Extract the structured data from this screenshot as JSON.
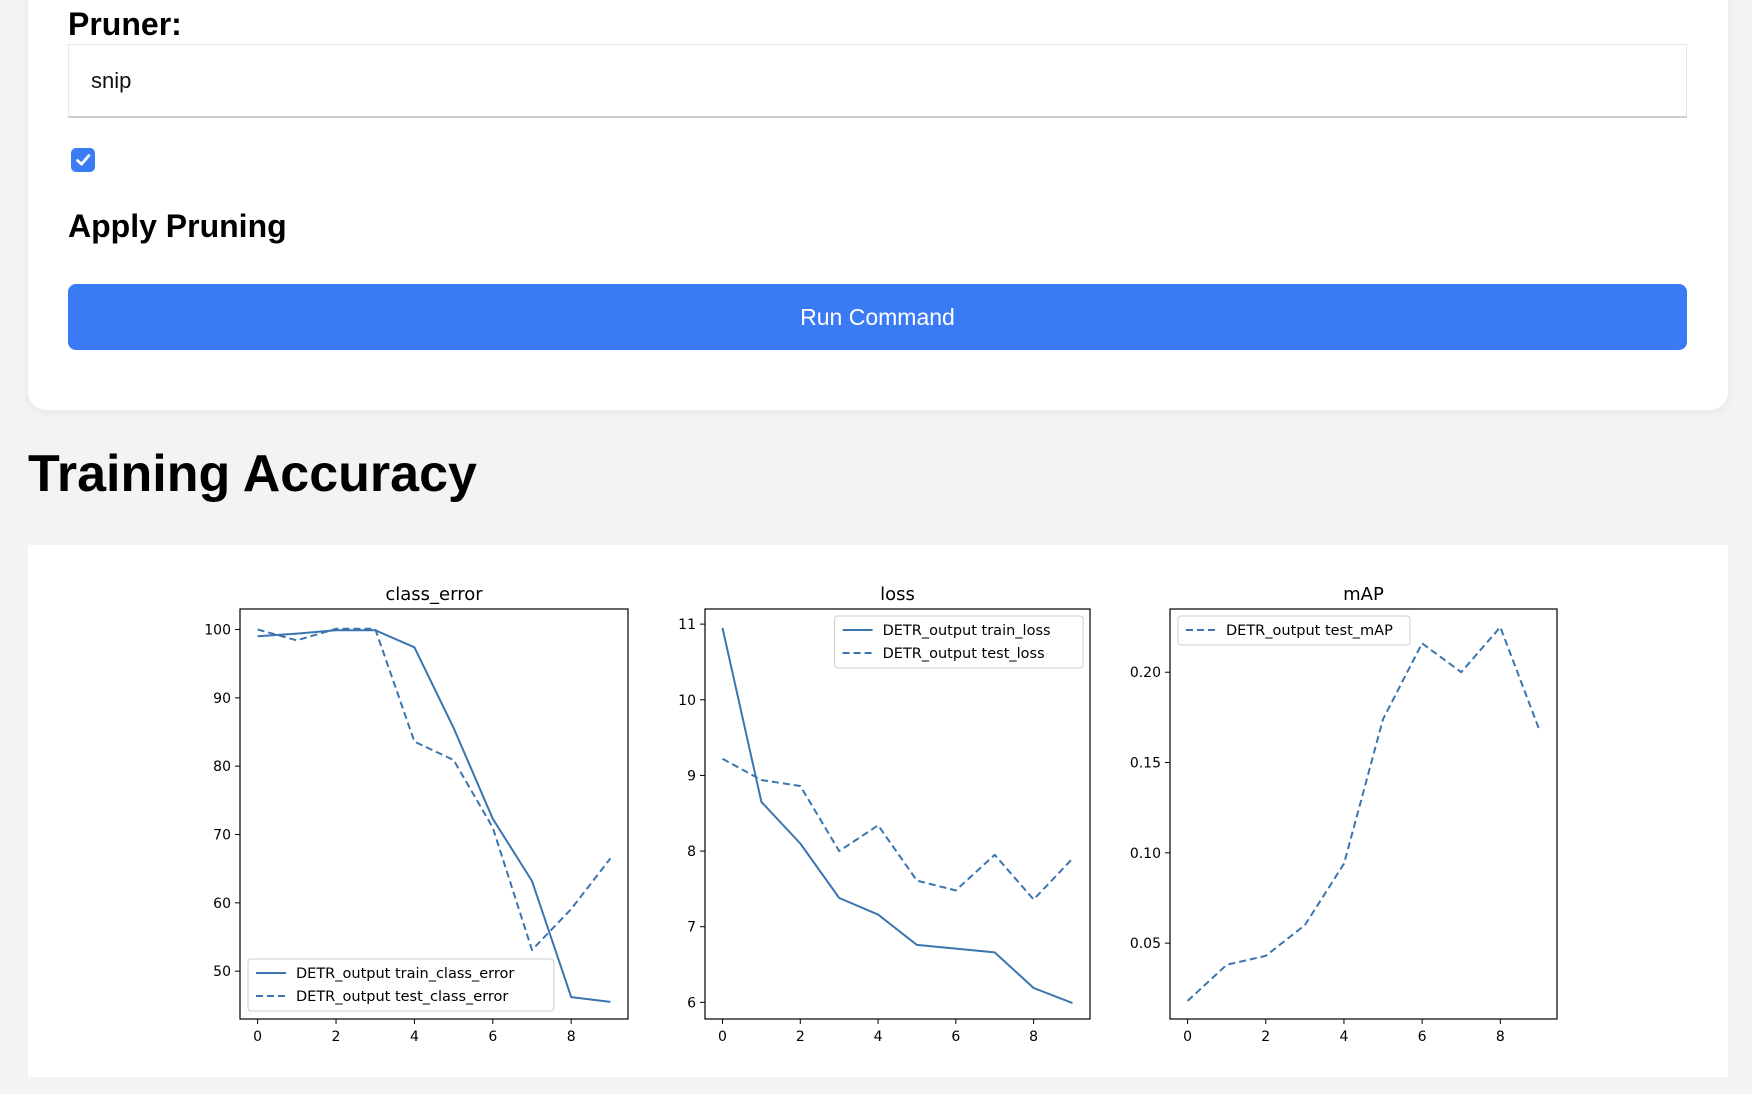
{
  "form": {
    "pruner_label": "Pruner:",
    "pruner_value": "snip",
    "apply_pruning_checked": true,
    "apply_pruning_label": "Apply Pruning",
    "run_button_label": "Run Command"
  },
  "section": {
    "title": "Training Accuracy"
  },
  "colors": {
    "accent": "#3a7af5",
    "series": "#3b75af"
  },
  "chart_data": [
    {
      "type": "line",
      "title": "class_error",
      "xlim": [
        -0.45,
        9.45
      ],
      "ylim": [
        43,
        103
      ],
      "xticks": [
        0,
        2,
        4,
        6,
        8
      ],
      "yticks": [
        50,
        60,
        70,
        80,
        90,
        100
      ],
      "legend": "lower-left",
      "series": [
        {
          "name": "DETR_output train_class_error",
          "style": "solid",
          "x": [
            0,
            1,
            2,
            3,
            4,
            5,
            6,
            7,
            8,
            9
          ],
          "y": [
            99.0,
            99.4,
            99.9,
            99.9,
            97.4,
            85.6,
            72.3,
            63.2,
            46.2,
            45.5
          ]
        },
        {
          "name": "DETR_output test_class_error",
          "style": "dashed",
          "x": [
            0,
            1,
            2,
            3,
            4,
            5,
            6,
            7,
            8,
            9
          ],
          "y": [
            100.0,
            98.4,
            100.1,
            100.1,
            83.6,
            80.9,
            71.0,
            53.1,
            59.1,
            66.5
          ]
        }
      ]
    },
    {
      "type": "line",
      "title": "loss",
      "xlim": [
        -0.45,
        9.45
      ],
      "ylim": [
        5.78,
        11.2
      ],
      "xticks": [
        0,
        2,
        4,
        6,
        8
      ],
      "yticks": [
        6,
        7,
        8,
        9,
        10,
        11
      ],
      "legend": "upper-right",
      "series": [
        {
          "name": "DETR_output train_loss",
          "style": "solid",
          "x": [
            0,
            1,
            2,
            3,
            4,
            5,
            6,
            7,
            8,
            9
          ],
          "y": [
            10.95,
            8.65,
            8.1,
            7.38,
            7.16,
            6.76,
            6.71,
            6.66,
            6.19,
            5.99
          ]
        },
        {
          "name": "DETR_output test_loss",
          "style": "dashed",
          "x": [
            0,
            1,
            2,
            3,
            4,
            5,
            6,
            7,
            8,
            9
          ],
          "y": [
            9.22,
            8.94,
            8.86,
            8.0,
            8.34,
            7.61,
            7.48,
            7.95,
            7.36,
            7.9
          ]
        }
      ]
    },
    {
      "type": "line",
      "title": "mAP",
      "xlim": [
        -0.45,
        9.45
      ],
      "ylim": [
        0.008,
        0.235
      ],
      "xticks": [
        0,
        2,
        4,
        6,
        8
      ],
      "yticks": [
        0.05,
        0.1,
        0.15,
        0.2
      ],
      "legend": "upper-left",
      "series": [
        {
          "name": "DETR_output test_mAP",
          "style": "dashed",
          "x": [
            0,
            1,
            2,
            3,
            4,
            5,
            6,
            7,
            8,
            9
          ],
          "y": [
            0.018,
            0.038,
            0.043,
            0.06,
            0.094,
            0.174,
            0.216,
            0.2,
            0.225,
            0.168
          ]
        }
      ]
    }
  ]
}
